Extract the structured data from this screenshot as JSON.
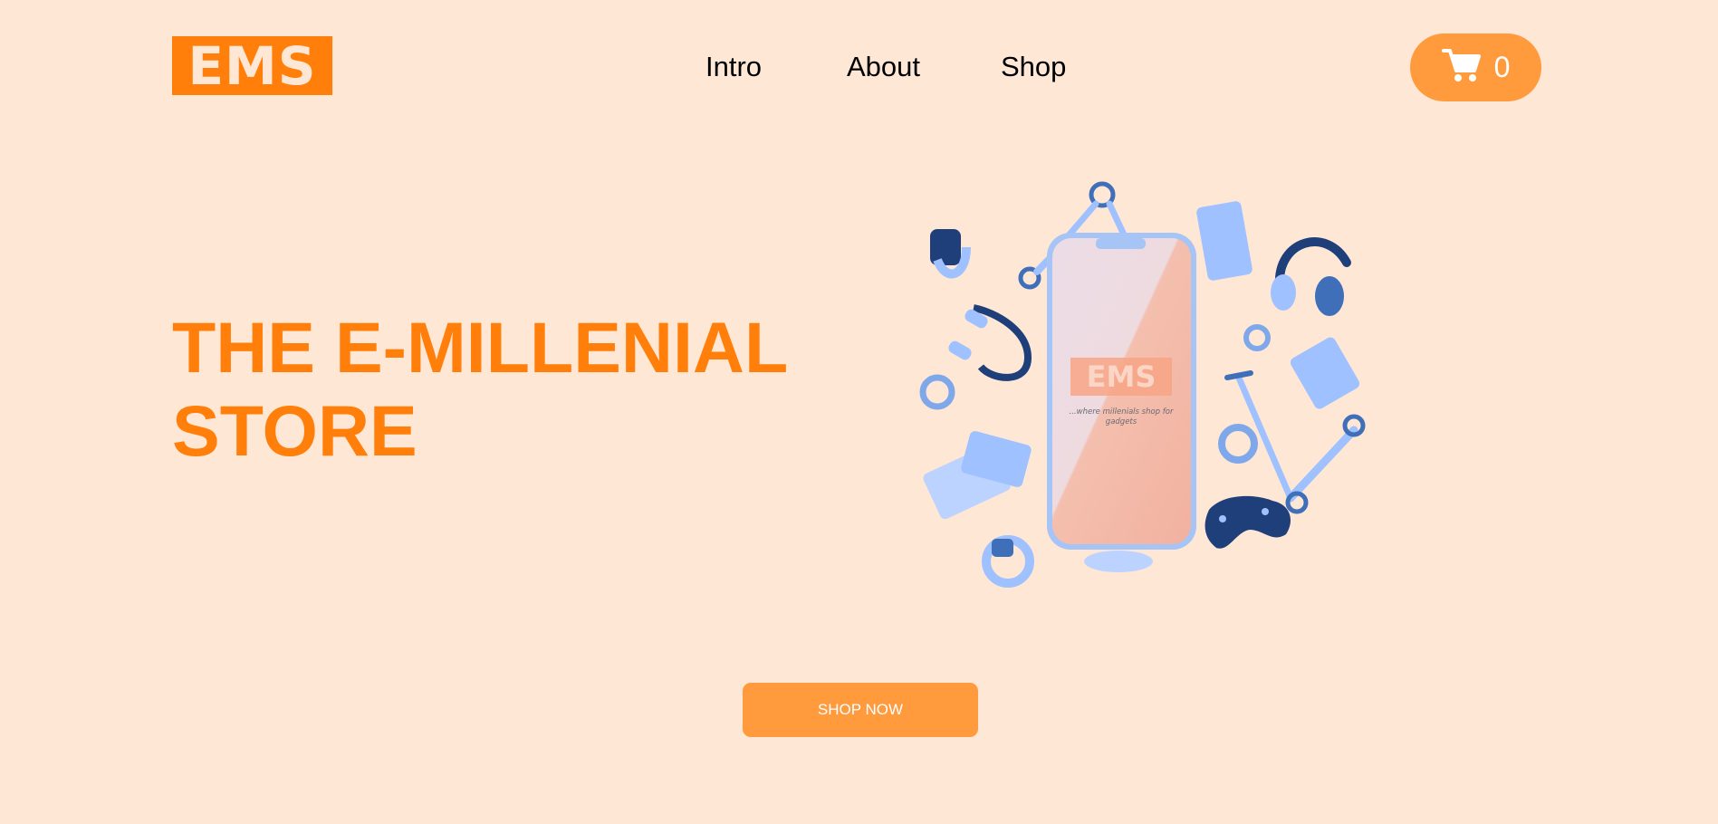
{
  "header": {
    "logo_text": "EMS",
    "nav": [
      {
        "label": "Intro"
      },
      {
        "label": "About"
      },
      {
        "label": "Shop"
      }
    ],
    "cart": {
      "icon": "cart-icon",
      "count": "0"
    }
  },
  "hero": {
    "headline_line1": "THE E-MILLENIAL",
    "headline_line2": "STORE",
    "image": {
      "screen_logo": "EMS",
      "tagline_line1": "...where millenials shop for",
      "tagline_line2": "gadgets"
    },
    "cta_label": "SHOP NOW"
  },
  "colors": {
    "background": "#ffe7d6",
    "brand_orange": "#ff7f0a",
    "button_orange": "#ff9b3d",
    "gadget_blue": "#9fc1ff",
    "gadget_dark_blue": "#1f3f7a"
  }
}
